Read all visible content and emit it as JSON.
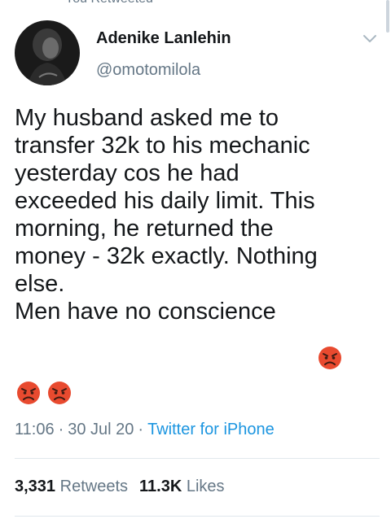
{
  "context_label": "You Retweeted",
  "author": {
    "name": "Adenike Lanlehin",
    "handle": "@omotomilola"
  },
  "tweet": {
    "text": "My husband asked me to\ntransfer 32k to his mechanic\nyesterday cos he had\nexceeded his daily limit. This\nmorning, he returned the\nmoney - 32k exactly. Nothing\nelse.\nMen have no conscience",
    "emojis": [
      "angry-face-icon",
      "angry-face-icon",
      "angry-face-icon"
    ]
  },
  "meta": {
    "time": "11:06",
    "date": "30 Jul 20",
    "source": "Twitter for iPhone",
    "separator": "·"
  },
  "stats": {
    "retweets_count": "3,331",
    "retweets_label": "Retweets",
    "likes_count": "11.3K",
    "likes_label": "Likes"
  },
  "colors": {
    "text": "#14171a",
    "secondary": "#657786",
    "link": "#1b95e0",
    "divider": "#e1e8ed"
  }
}
